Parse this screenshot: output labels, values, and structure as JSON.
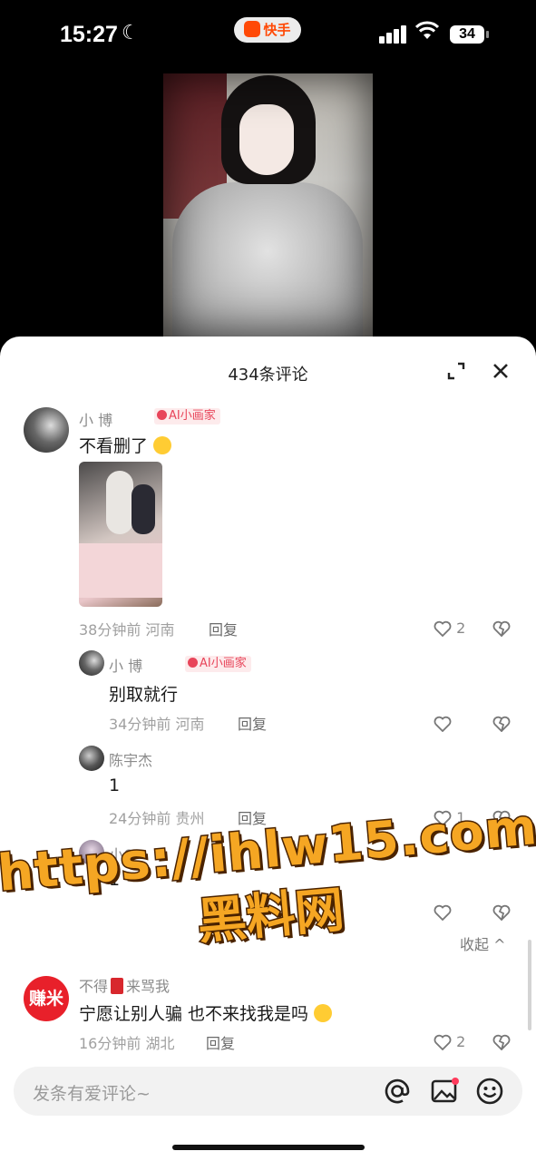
{
  "status_bar": {
    "time": "15:27",
    "app_label": "快手",
    "battery": "34"
  },
  "comments_panel": {
    "title": "434条评论",
    "comments": [
      {
        "name": "小 博",
        "badge": "AI小画家",
        "text": "不看删了",
        "meta": "38分钟前 河南",
        "reply_label": "回复",
        "likes": "2",
        "replies": [
          {
            "name": "小 博",
            "badge": "AI小画家",
            "text": "别取就行",
            "meta": "34分钟前 河南",
            "reply_label": "回复",
            "likes": ""
          },
          {
            "name": "陈宇杰",
            "text": "1",
            "meta": "24分钟前 贵州",
            "reply_label": "回复",
            "likes": "1"
          },
          {
            "name": "小6.",
            "text": "1",
            "likes": ""
          }
        ]
      },
      {
        "name": "不得",
        "name_suffix": "来骂我",
        "avatar_text": "赚米",
        "text": "宁愿让别人骗 也不来找我是吗",
        "meta": "16分钟前 湖北",
        "reply_label": "回复",
        "likes": "2"
      }
    ],
    "collapse_label": "收起 ^"
  },
  "watermark": {
    "url": "https://ihlw15.com",
    "label": "黑料网"
  },
  "input": {
    "placeholder": "发条有爱评论~"
  },
  "colors": {
    "accent": "#ff4906",
    "badge": "#e8455a",
    "watermark": "#f5a623"
  }
}
